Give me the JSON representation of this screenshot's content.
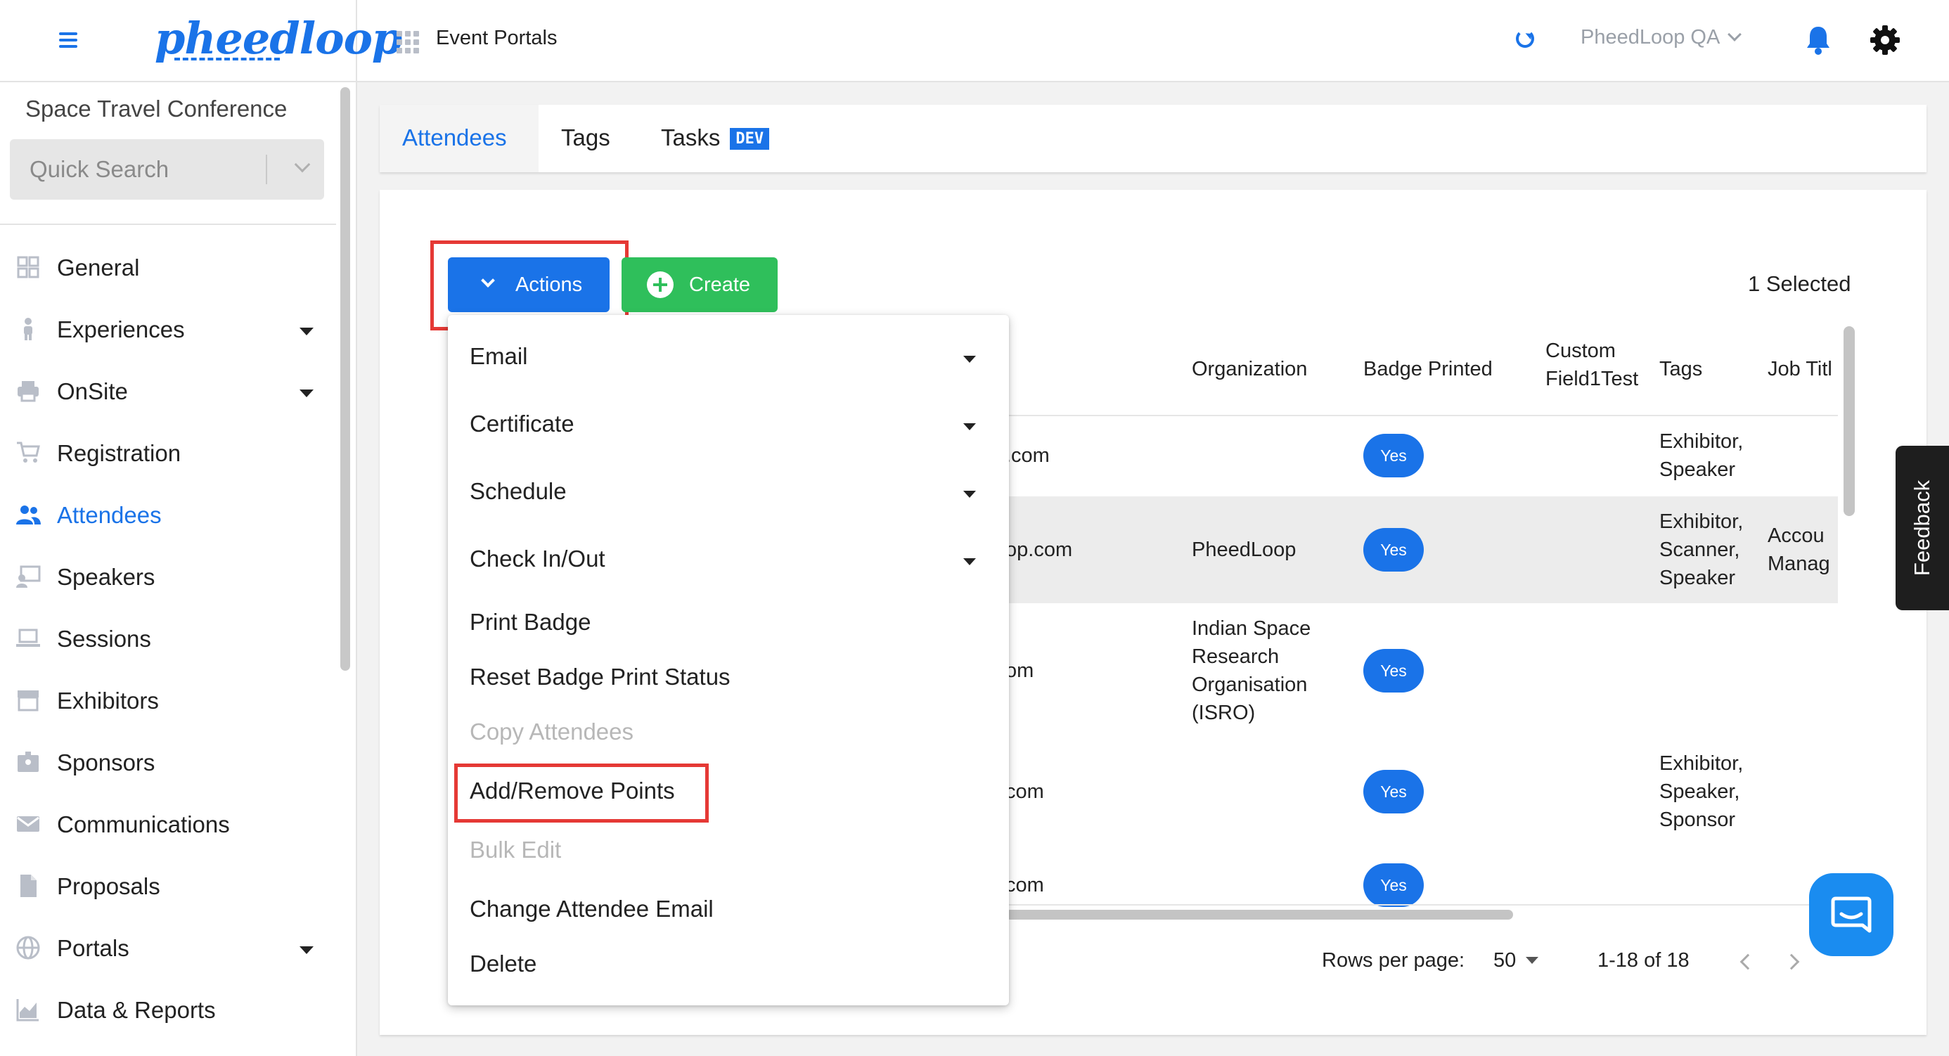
{
  "header": {
    "logo_text": "pheedloop",
    "title": "Event Portals",
    "org_name": "PheedLoop QA"
  },
  "sidebar": {
    "event_name": "Space Travel Conference",
    "search_placeholder": "Quick Search",
    "items": [
      {
        "label": "General",
        "icon": "grid-icon",
        "has_caret": false,
        "active": false
      },
      {
        "label": "Experiences",
        "icon": "person-icon",
        "has_caret": true,
        "active": false
      },
      {
        "label": "OnSite",
        "icon": "printer-icon",
        "has_caret": true,
        "active": false
      },
      {
        "label": "Registration",
        "icon": "cart-icon",
        "has_caret": false,
        "active": false
      },
      {
        "label": "Attendees",
        "icon": "people-icon",
        "has_caret": false,
        "active": true
      },
      {
        "label": "Speakers",
        "icon": "presenter-icon",
        "has_caret": false,
        "active": false
      },
      {
        "label": "Sessions",
        "icon": "laptop-icon",
        "has_caret": false,
        "active": false
      },
      {
        "label": "Exhibitors",
        "icon": "storefront-icon",
        "has_caret": false,
        "active": false
      },
      {
        "label": "Sponsors",
        "icon": "badge-icon",
        "has_caret": false,
        "active": false
      },
      {
        "label": "Communications",
        "icon": "mail-icon",
        "has_caret": false,
        "active": false
      },
      {
        "label": "Proposals",
        "icon": "document-icon",
        "has_caret": false,
        "active": false
      },
      {
        "label": "Portals",
        "icon": "globe-icon",
        "has_caret": true,
        "active": false
      },
      {
        "label": "Data & Reports",
        "icon": "chart-icon",
        "has_caret": false,
        "active": false
      }
    ]
  },
  "tabs": [
    {
      "label": "Attendees",
      "active": true
    },
    {
      "label": "Tags",
      "active": false
    },
    {
      "label": "Tasks",
      "active": false,
      "badge": "DEV"
    }
  ],
  "toolbar": {
    "actions_label": "Actions",
    "create_label": "Create",
    "selected_text": "1 Selected"
  },
  "actions_menu": [
    {
      "label": "Email",
      "submenu": true,
      "disabled": false
    },
    {
      "label": "Certificate",
      "submenu": true,
      "disabled": false
    },
    {
      "label": "Schedule",
      "submenu": true,
      "disabled": false
    },
    {
      "label": "Check In/Out",
      "submenu": true,
      "disabled": false
    },
    {
      "label": "Print Badge",
      "submenu": false,
      "disabled": false
    },
    {
      "label": "Reset Badge Print Status",
      "submenu": false,
      "disabled": false
    },
    {
      "label": "Copy Attendees",
      "submenu": false,
      "disabled": true
    },
    {
      "label": "Add/Remove Points",
      "submenu": false,
      "disabled": false
    },
    {
      "label": "Bulk Edit",
      "submenu": false,
      "disabled": true
    },
    {
      "label": "Change Attendee Email",
      "submenu": false,
      "disabled": false
    },
    {
      "label": "Delete",
      "submenu": false,
      "disabled": false
    }
  ],
  "table": {
    "headers": [
      "Organization",
      "Badge Printed",
      "Custom Field1Test",
      "Tags",
      "Job Titl"
    ],
    "rows": [
      {
        "email_fragment": ".com",
        "organization": "",
        "badge": "Yes",
        "tags": [
          "Exhibitor,",
          "Speaker"
        ],
        "job": []
      },
      {
        "email_fragment": "op.com",
        "organization": "PheedLoop",
        "badge": "Yes",
        "tags": [
          "Exhibitor,",
          "Scanner,",
          "Speaker"
        ],
        "job": [
          "Accou",
          "Manag"
        ]
      },
      {
        "email_fragment": "om",
        "organization": "Indian Space Research Organisation (ISRO)",
        "badge": "Yes",
        "tags": [],
        "job": []
      },
      {
        "email_fragment": "com",
        "organization": "",
        "badge": "Yes",
        "tags": [
          "Exhibitor,",
          "Speaker,",
          "Sponsor"
        ],
        "job": []
      },
      {
        "email_fragment": "com",
        "organization": "",
        "badge": "Yes",
        "tags": [],
        "job": []
      }
    ]
  },
  "pagination": {
    "rows_per_page_label": "Rows per page:",
    "rows_per_page_value": "50",
    "range_text": "1-18 of 18"
  },
  "feedback_label": "Feedback",
  "colors": {
    "primary": "#1a73e8",
    "success": "#2fbf5b",
    "highlight": "#e53935"
  }
}
